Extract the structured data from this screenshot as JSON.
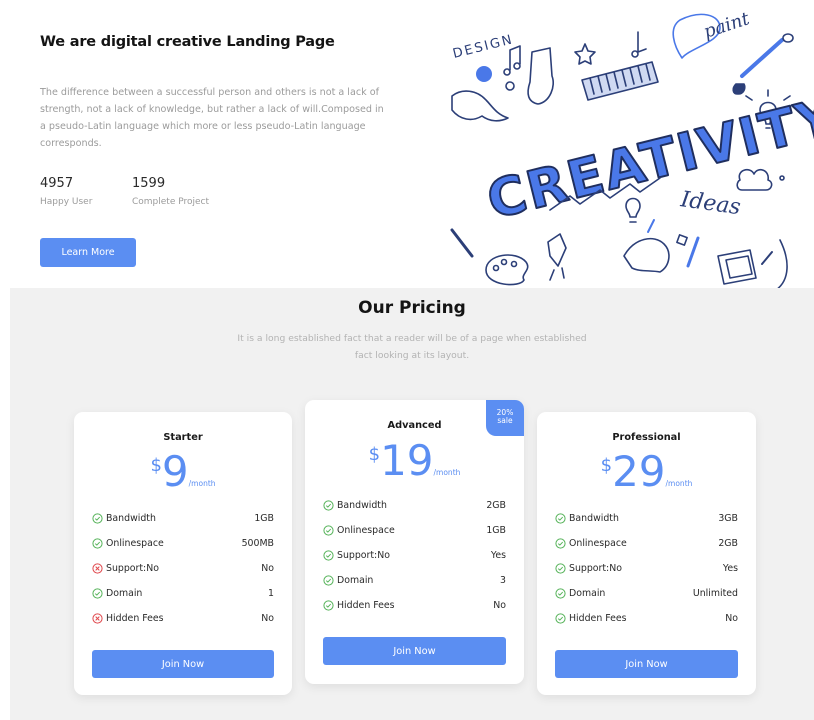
{
  "hero": {
    "title": "We are digital creative Landing Page",
    "description": "The difference between a successful person and others is not a lack of strength, not a lack of knowledge, but rather a lack of will.Composed in a pseudo-Latin language which more or less pseudo-Latin language corresponds.",
    "stats": [
      {
        "value": "4957",
        "label": "Happy User"
      },
      {
        "value": "1599",
        "label": "Complete Project"
      }
    ],
    "cta_label": "Learn More",
    "illustration": {
      "main_word": "CREATIVITY",
      "words": [
        "DESIGN",
        "paint",
        "Ideas"
      ]
    }
  },
  "pricing": {
    "title": "Our Pricing",
    "subtitle": "It is a long established fact that a reader will be of a page when established fact looking at its layout.",
    "accent_color": "#5b8ef2",
    "plans": [
      {
        "name": "Starter",
        "currency": "$",
        "amount": "9",
        "period": "/month",
        "button": "Join Now",
        "features": [
          {
            "name": "Bandwidth",
            "value": "1GB",
            "icon": "check-circle-icon"
          },
          {
            "name": "Onlinespace",
            "value": "500MB",
            "icon": "check-circle-icon"
          },
          {
            "name": "Support:No",
            "value": "No",
            "icon": "x-circle-icon"
          },
          {
            "name": "Domain",
            "value": "1",
            "icon": "check-circle-icon"
          },
          {
            "name": "Hidden Fees",
            "value": "No",
            "icon": "x-circle-icon"
          }
        ]
      },
      {
        "name": "Advanced",
        "currency": "$",
        "amount": "19",
        "period": "/month",
        "badge": "20% sale",
        "badge_line1": "20%",
        "badge_line2": "sale",
        "button": "Join Now",
        "features": [
          {
            "name": "Bandwidth",
            "value": "2GB",
            "icon": "check-circle-icon"
          },
          {
            "name": "Onlinespace",
            "value": "1GB",
            "icon": "check-circle-icon"
          },
          {
            "name": "Support:No",
            "value": "Yes",
            "icon": "check-circle-icon"
          },
          {
            "name": "Domain",
            "value": "3",
            "icon": "check-circle-icon"
          },
          {
            "name": "Hidden Fees",
            "value": "No",
            "icon": "check-circle-icon"
          }
        ]
      },
      {
        "name": "Professional",
        "currency": "$",
        "amount": "29",
        "period": "/month",
        "button": "Join Now",
        "features": [
          {
            "name": "Bandwidth",
            "value": "3GB",
            "icon": "check-circle-icon"
          },
          {
            "name": "Onlinespace",
            "value": "2GB",
            "icon": "check-circle-icon"
          },
          {
            "name": "Support:No",
            "value": "Yes",
            "icon": "check-circle-icon"
          },
          {
            "name": "Domain",
            "value": "Unlimited",
            "icon": "check-circle-icon"
          },
          {
            "name": "Hidden Fees",
            "value": "No",
            "icon": "check-circle-icon"
          }
        ]
      }
    ]
  }
}
